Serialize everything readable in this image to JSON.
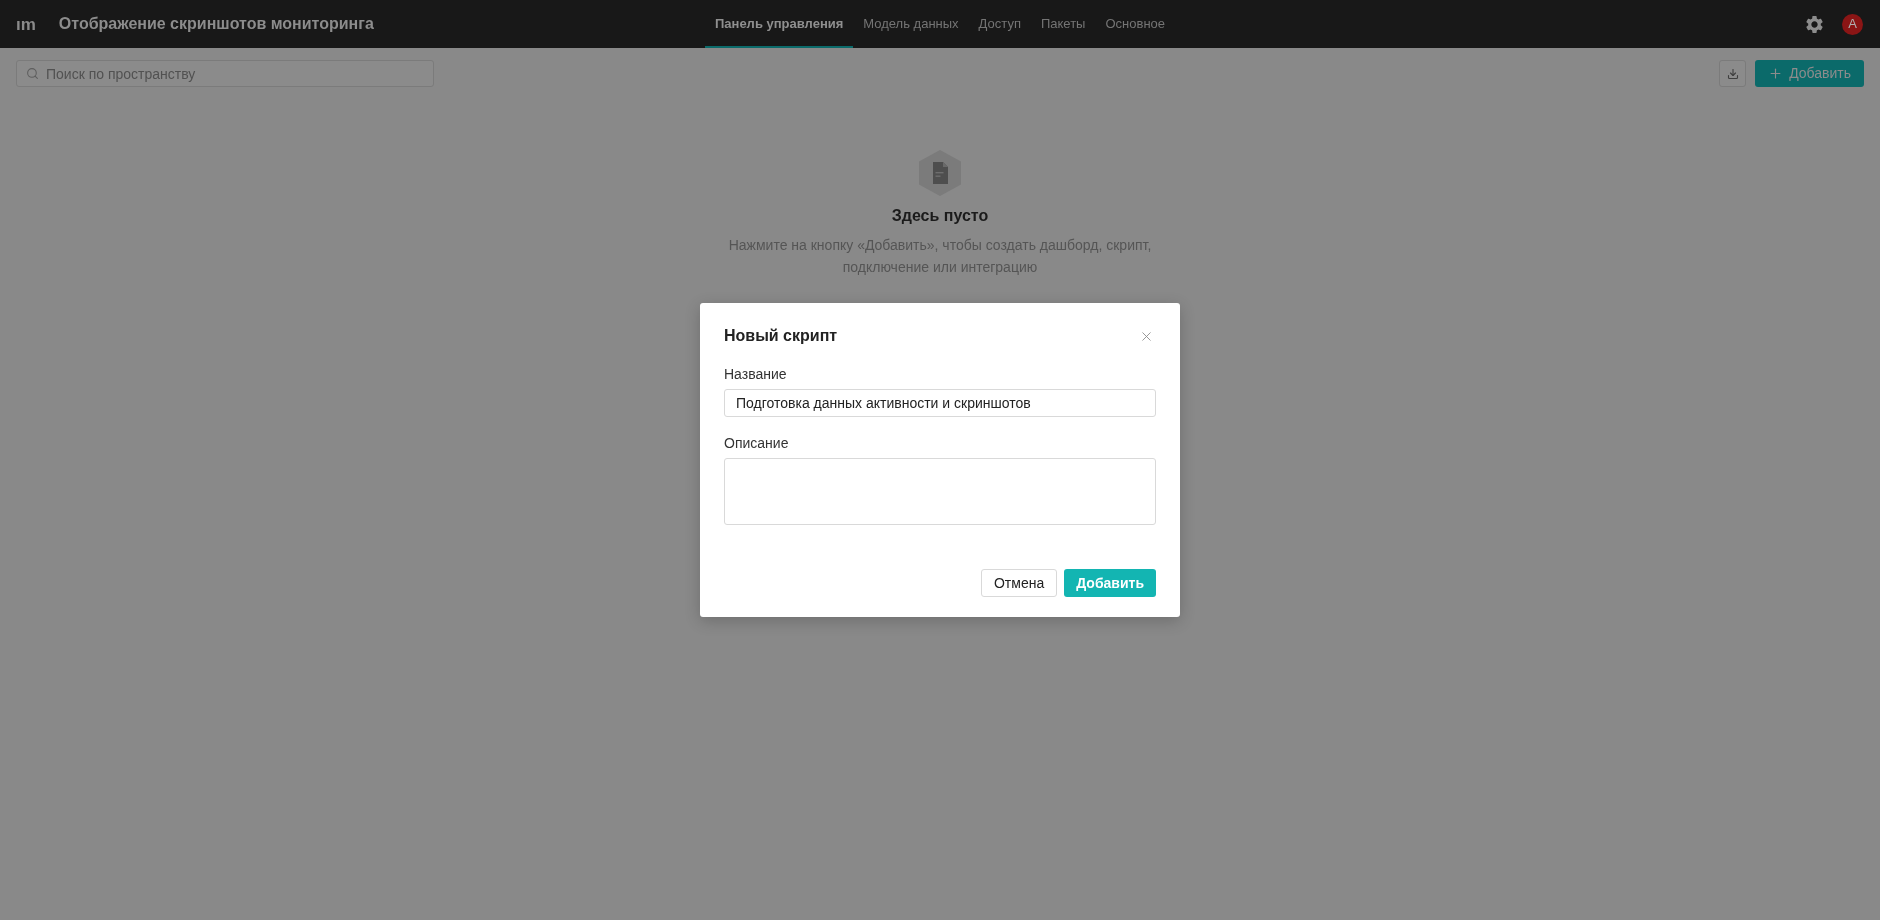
{
  "app": {
    "logo": "ım",
    "title": "Отображение скриншотов мониторинга"
  },
  "tabs": [
    {
      "label": "Панель управления",
      "selected": true
    },
    {
      "label": "Модель данных",
      "selected": false
    },
    {
      "label": "Доступ",
      "selected": false
    },
    {
      "label": "Пакеты",
      "selected": false
    },
    {
      "label": "Основное",
      "selected": false
    }
  ],
  "user": {
    "avatar_initial": "A"
  },
  "toolbar": {
    "search": {
      "placeholder": "Поиск по пространству"
    },
    "add_button": "Добавить"
  },
  "empty_state": {
    "title": "Здесь пусто",
    "description": "Нажмите на кнопку «Добавить», чтобы создать дашборд, скрипт, подключение или интеграцию"
  },
  "dialog": {
    "title": "Новый скрипт",
    "fields": [
      {
        "kind": "input",
        "label": "Название",
        "value": "Подготовка данных активности и скриншотов"
      },
      {
        "kind": "textarea",
        "label": "Описание"
      }
    ],
    "buttons": [
      {
        "kind": "secondary",
        "label": "Отмена"
      },
      {
        "kind": "primary",
        "label": "Добавить"
      }
    ]
  }
}
